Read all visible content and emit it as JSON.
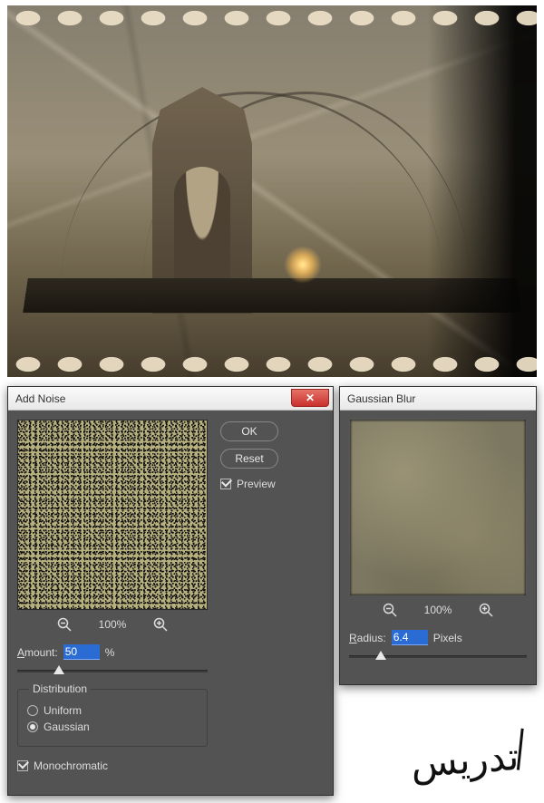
{
  "addNoise": {
    "title": "Add Noise",
    "close_glyph": "✕",
    "ok_label": "OK",
    "reset_label": "Reset",
    "preview_label": "Preview",
    "preview_checked": true,
    "zoom_level": "100%",
    "amount_label": "Amount:",
    "amount_value": "50",
    "amount_unit": "%",
    "amount_slider_pct": 22,
    "distribution": {
      "legend": "Distribution",
      "uniform_label": "Uniform",
      "gaussian_label": "Gaussian",
      "selected": "gaussian"
    },
    "monochromatic_label": "Monochromatic",
    "monochromatic_checked": true
  },
  "gaussianBlur": {
    "title": "Gaussian Blur",
    "zoom_level": "100%",
    "radius_label": "Radius:",
    "radius_value": "6.4",
    "radius_unit": "Pixels",
    "radius_slider_pct": 18
  },
  "watermark_text": "تدریس"
}
